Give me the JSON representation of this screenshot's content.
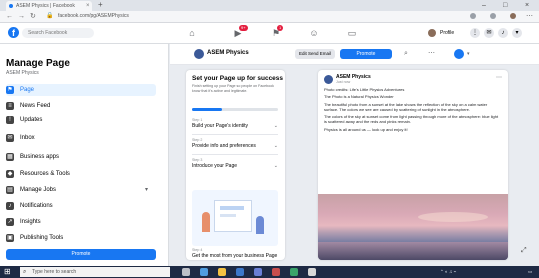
{
  "browser": {
    "tab_title": "ASEM Physics | Facebook",
    "tab_close": "×",
    "new_tab": "+",
    "url": "facebook.com/pg/ASEMPhysics",
    "window_controls": [
      "–",
      "□",
      "×"
    ]
  },
  "fb_bar": {
    "logo": "f",
    "search_placeholder": "Search Facebook",
    "badges": {
      "watch": "9+",
      "notifications": "1"
    },
    "profile_name": "Profile"
  },
  "sidebar": {
    "title": "Manage Page",
    "subtitle": "ASEM Physics",
    "items": [
      {
        "label": "Page",
        "icon": "flag-icon"
      },
      {
        "label": "News Feed",
        "icon": "newsfeed-icon"
      },
      {
        "label": "Updates",
        "icon": "updates-icon"
      },
      {
        "label": "Inbox",
        "icon": "inbox-icon"
      },
      {
        "label": "Business apps",
        "icon": "apps-icon"
      },
      {
        "label": "Resources & Tools",
        "icon": "resources-icon"
      },
      {
        "label": "Manage Jobs",
        "icon": "jobs-icon"
      },
      {
        "label": "Notifications",
        "icon": "bell-icon"
      },
      {
        "label": "Insights",
        "icon": "insights-icon"
      },
      {
        "label": "Publishing Tools",
        "icon": "publishing-icon"
      }
    ],
    "promote_label": "Promote"
  },
  "page_bar": {
    "page_name": "ASEM Physics",
    "edit_label": "Edit Send Email",
    "promote_label": "Promote"
  },
  "setup_card": {
    "title": "Set your Page up for success",
    "description": "Finish setting up your Page so people on Facebook know that it's active and legitimate.",
    "progress": 0.35,
    "steps": [
      {
        "meta": "Step 1",
        "label": "Build your Page's identity"
      },
      {
        "meta": "Step 2",
        "label": "Provide info and preferences"
      },
      {
        "meta": "Step 3",
        "label": "Introduce your Page"
      }
    ],
    "footer_meta": "Step 4",
    "footer_label": "Get the most from your business Page"
  },
  "post": {
    "author": "ASEM Physics",
    "time": "Just now",
    "paragraphs": [
      "Photo credits: Life's Little Physics Adventures",
      "The Photo is a Natural Physics Wonder",
      "The beautiful photo from a sunset at the lake shows the reflection of the sky on a calm water surface. The colors we see are caused by scattering of sunlight in the atmosphere.",
      "The colors of the sky at sunset come from light passing through more of the atmosphere: blue light is scattered away and the reds and pinks remain.",
      "Physics is all around us — look up and enjoy it!"
    ]
  }
}
